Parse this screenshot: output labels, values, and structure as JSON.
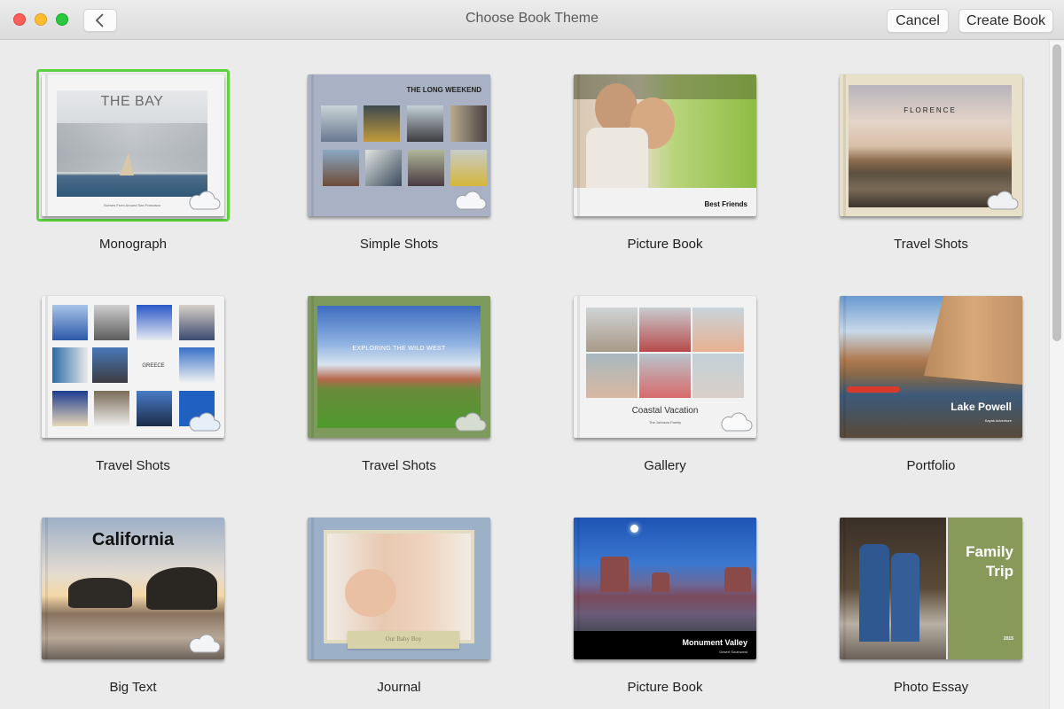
{
  "window": {
    "title": "Choose Book Theme",
    "buttons": {
      "back": "back",
      "cancel": "Cancel",
      "create": "Create Book"
    }
  },
  "selected_index": 0,
  "accent_color": "#5ed13e",
  "themes": [
    {
      "name": "Monograph",
      "cover_title": "THE BAY",
      "cover_subtitle": "Scenes From Around San Francisco",
      "cloud_icon": true
    },
    {
      "name": "Simple Shots",
      "cover_title": "THE LONG WEEKEND",
      "cloud_icon": true
    },
    {
      "name": "Picture Book",
      "cover_title": "Best Friends",
      "cloud_icon": false
    },
    {
      "name": "Travel Shots",
      "cover_title": "FLORENCE",
      "cloud_icon": true
    },
    {
      "name": "Travel Shots",
      "cover_title": "GREECE",
      "cloud_icon": true
    },
    {
      "name": "Travel Shots",
      "cover_title": "EXPLORING THE WILD WEST",
      "cloud_icon": true
    },
    {
      "name": "Gallery",
      "cover_title": "Coastal Vacation",
      "cover_subtitle": "The Johnson Family",
      "cloud_icon": true
    },
    {
      "name": "Portfolio",
      "cover_title": "Lake Powell",
      "cover_subtitle": "Kayak Adventure",
      "cloud_icon": false
    },
    {
      "name": "Big Text",
      "cover_title": "California",
      "cloud_icon": true
    },
    {
      "name": "Journal",
      "cover_title": "Our Baby Boy",
      "cloud_icon": false
    },
    {
      "name": "Picture Book",
      "cover_title": "Monument Valley",
      "cover_subtitle": "Desert Southwest",
      "cloud_icon": false
    },
    {
      "name": "Photo Essay",
      "cover_title": "Family Trip",
      "cover_subtitle": "2015",
      "cloud_icon": false
    }
  ]
}
